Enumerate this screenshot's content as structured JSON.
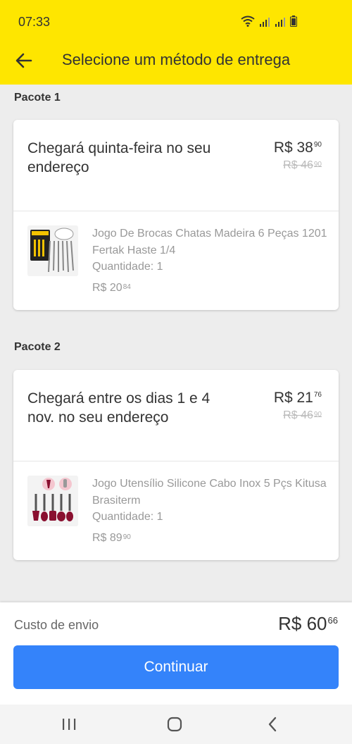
{
  "status_bar": {
    "time": "07:33",
    "icons": [
      "wifi-icon",
      "signal-icon",
      "signal-icon",
      "battery-icon"
    ]
  },
  "app_bar": {
    "title": "Selecione um método de entrega",
    "back_icon": "arrow-left-icon"
  },
  "packages": [
    {
      "label": "Pacote 1",
      "delivery_text": "Chegará quinta-feira no seu endereço",
      "price_main": "R$ 38",
      "price_cents": "90",
      "old_price_main": "R$ 46",
      "old_price_cents": "90",
      "item": {
        "title": "Jogo De Brocas Chatas Madeira 6 Peças 1201 Fertak Haste 1/4",
        "quantity": "Quantidade: 1",
        "price_main": "R$ 20",
        "price_cents": "84"
      }
    },
    {
      "label": "Pacote 2",
      "delivery_text": "Chegará entre os dias 1 e 4 nov. no seu endereço",
      "price_main": "R$ 21",
      "price_cents": "76",
      "old_price_main": "R$ 46",
      "old_price_cents": "90",
      "item": {
        "title": "Jogo Utensílio Silicone Cabo Inox 5 Pçs Kitusa Brasiterm",
        "quantity": "Quantidade: 1",
        "price_main": "R$ 89",
        "price_cents": "90"
      }
    }
  ],
  "footer": {
    "shipping_label": "Custo de envio",
    "total_main": "R$ 60",
    "total_cents": "66",
    "continue_label": "Continuar"
  },
  "nav_bar": {
    "icons": [
      "recent-apps-icon",
      "home-icon",
      "back-icon"
    ]
  },
  "colors": {
    "brand_yellow": "#fee600",
    "primary_blue": "#3483fa",
    "background": "#ededed"
  }
}
